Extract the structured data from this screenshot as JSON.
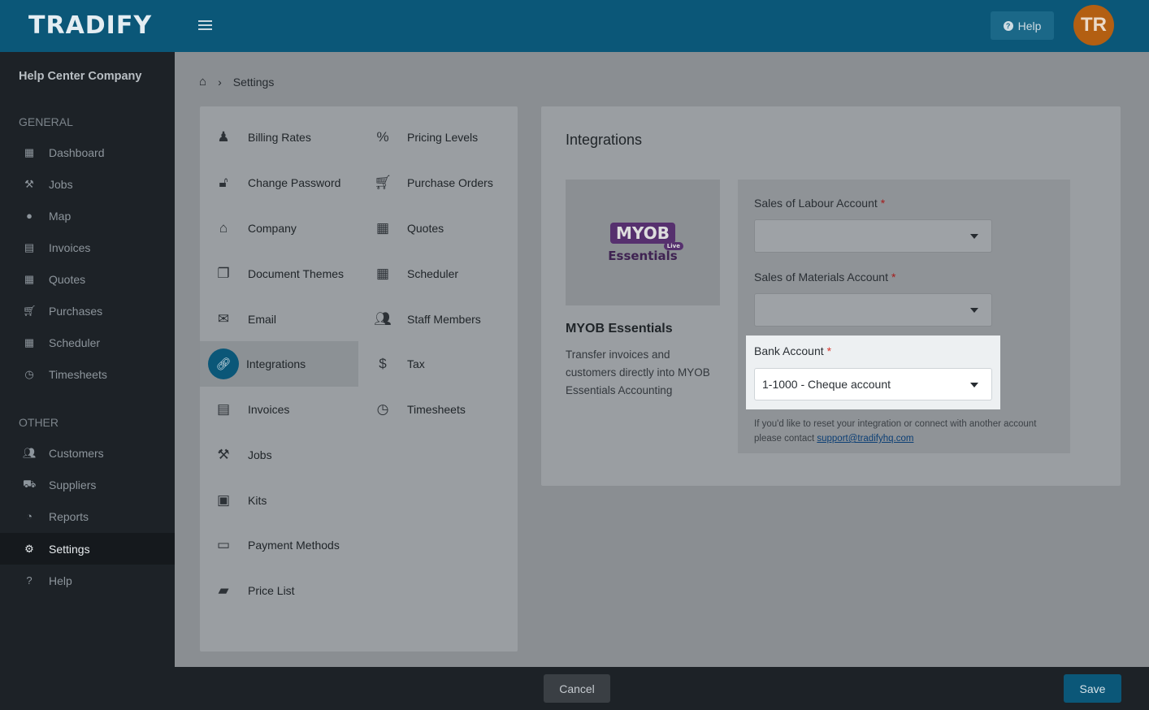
{
  "header": {
    "logo": "TRADIFY",
    "help_label": "Help",
    "avatar_initials": "TR"
  },
  "sidebar": {
    "company": "Help Center Company",
    "general_title": "GENERAL",
    "other_title": "OTHER",
    "general_items": [
      {
        "label": "Dashboard",
        "icon": "dashboard-icon"
      },
      {
        "label": "Jobs",
        "icon": "hammer-icon"
      },
      {
        "label": "Map",
        "icon": "map-marker-icon"
      },
      {
        "label": "Invoices",
        "icon": "invoice-icon"
      },
      {
        "label": "Quotes",
        "icon": "calculator-icon"
      },
      {
        "label": "Purchases",
        "icon": "cart-icon"
      },
      {
        "label": "Scheduler",
        "icon": "calendar-icon"
      },
      {
        "label": "Timesheets",
        "icon": "clock-icon"
      }
    ],
    "other_items": [
      {
        "label": "Customers",
        "icon": "users-icon"
      },
      {
        "label": "Suppliers",
        "icon": "truck-icon"
      },
      {
        "label": "Reports",
        "icon": "pie-chart-icon"
      },
      {
        "label": "Settings",
        "icon": "gear-icon",
        "active": true
      },
      {
        "label": "Help",
        "icon": "question-icon"
      }
    ]
  },
  "breadcrumb": {
    "current": "Settings"
  },
  "settings_menu": {
    "left": [
      {
        "label": "Billing Rates",
        "icon": "person-icon"
      },
      {
        "label": "Change Password",
        "icon": "lock-icon"
      },
      {
        "label": "Company",
        "icon": "home-icon"
      },
      {
        "label": "Document Themes",
        "icon": "documents-icon"
      },
      {
        "label": "Email",
        "icon": "envelope-icon"
      },
      {
        "label": "Integrations",
        "icon": "link-icon",
        "active": true
      },
      {
        "label": "Invoices",
        "icon": "file-icon"
      },
      {
        "label": "Jobs",
        "icon": "hammer-icon"
      },
      {
        "label": "Kits",
        "icon": "cubes-icon"
      },
      {
        "label": "Payment Methods",
        "icon": "money-icon"
      },
      {
        "label": "Price List",
        "icon": "book-icon"
      }
    ],
    "right": [
      {
        "label": "Pricing Levels",
        "icon": "percent-icon"
      },
      {
        "label": "Purchase Orders",
        "icon": "cart-icon"
      },
      {
        "label": "Quotes",
        "icon": "calculator-icon"
      },
      {
        "label": "Scheduler",
        "icon": "calendar-icon"
      },
      {
        "label": "Staff Members",
        "icon": "users-icon"
      },
      {
        "label": "Tax",
        "icon": "dollar-icon"
      },
      {
        "label": "Timesheets",
        "icon": "clock-icon"
      }
    ]
  },
  "integrations": {
    "title": "Integrations",
    "logo_mark": "MYOB",
    "logo_live": "Live",
    "logo_sub": "Essentials",
    "provider_name": "MYOB Essentials",
    "description": "Transfer invoices and customers directly into MYOB Essentials Accounting",
    "fields": {
      "labour_label": "Sales of Labour Account",
      "labour_value": "",
      "materials_label": "Sales of Materials Account",
      "materials_value": "",
      "bank_label": "Bank Account",
      "bank_value": "1-1000 - Cheque account",
      "required_mark": "*"
    },
    "note_text": "If you'd like to reset your integration or connect with another account please contact ",
    "note_email": "support@tradifyhq.com"
  },
  "footer": {
    "cancel_label": "Cancel",
    "save_label": "Save"
  },
  "colors": {
    "brand": "#0b5778",
    "sidebar": "#1d2227",
    "required": "#d9342b"
  }
}
